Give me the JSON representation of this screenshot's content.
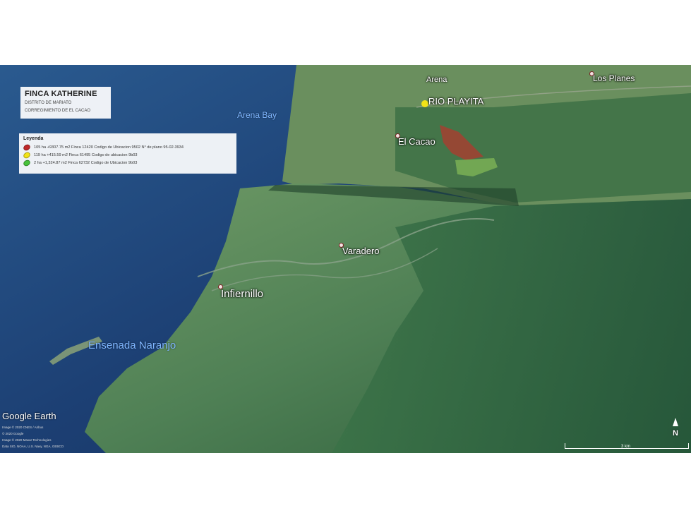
{
  "title_box": {
    "title": "FINCA KATHERINE",
    "line1": "DISTRITO DE MARIATO",
    "line2": "CORREGIMIENTO DE EL CACAO"
  },
  "legend": {
    "heading": "Leyenda",
    "items": [
      {
        "text": "105 ha +9307.75 m2 Finca 12420 Codigo de Ubicacion 9502 N° de plano 95-02-3934",
        "color": "#c0282a"
      },
      {
        "text": "119 ha +415.59 m2 Finca 61495 Codigo de ubicacion 9b03",
        "color": "#f2e318"
      },
      {
        "text": "2 ha +1,324.87 m2 Finca 62732 Codigo de Ubicacion 9b03",
        "color": "#47c23a"
      }
    ]
  },
  "places": {
    "arena": "Arena",
    "rio_playita": "RIO PLAYITA",
    "los_planes": "Los Planes",
    "arena_bay": "Arena Bay",
    "el_cacao": "El Cacao",
    "varadero": "Varadero",
    "infiernillo": "Infiernillo",
    "ensenada_naranjo": "Ensenada Naranjo"
  },
  "branding": {
    "logo": "Google Earth",
    "attribution": [
      "Image © 2020 CNES / Airbus",
      "© 2020 Google",
      "Image © 2020 Maxar Technologies",
      "Data SIO, NOAA, U.S. Navy, NGA, GEBCO"
    ]
  },
  "scale_bar": {
    "label": "3 km"
  },
  "compass": {
    "label": "N",
    "icon": "north-arrow-icon"
  },
  "colors": {
    "ocean_deep": "#1c3f73",
    "ocean_shallow": "#3d6fa0",
    "land": "#5f8a5a",
    "forest": "#2f6b3e",
    "parcel_red": "#b03a2e",
    "parcel_green": "#7ab055"
  }
}
